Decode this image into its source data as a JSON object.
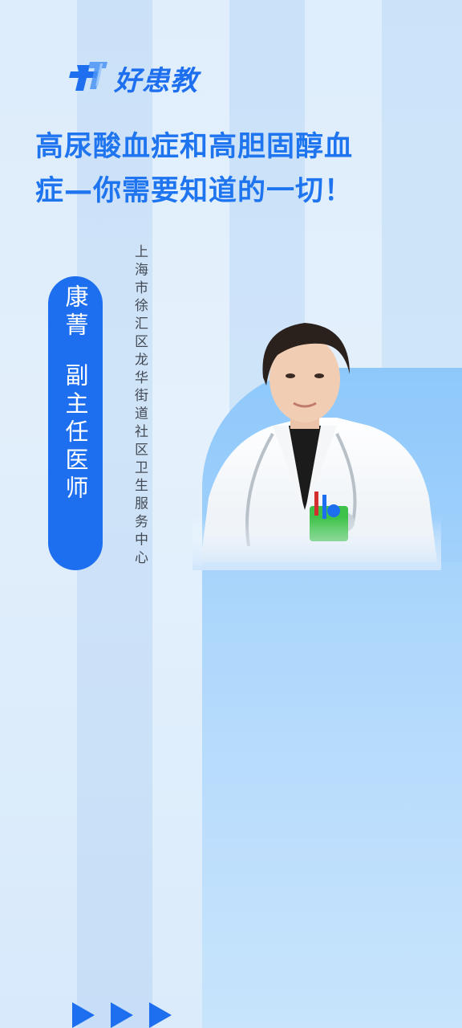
{
  "brand": {
    "logo_text": "好患教",
    "logo_icon": "medical-cross-logo-icon",
    "primary_color": "#1e6ff0"
  },
  "title": "高尿酸血症和高胆固醇血症—你需要知道的一切！",
  "doctor": {
    "name": "康菁",
    "position": "副主任医师",
    "institution": "上海市徐汇区龙华街道社区卫生服务中心"
  },
  "footer": {
    "arrow_icon": "play-arrow-icon",
    "arrow_count": 3
  }
}
